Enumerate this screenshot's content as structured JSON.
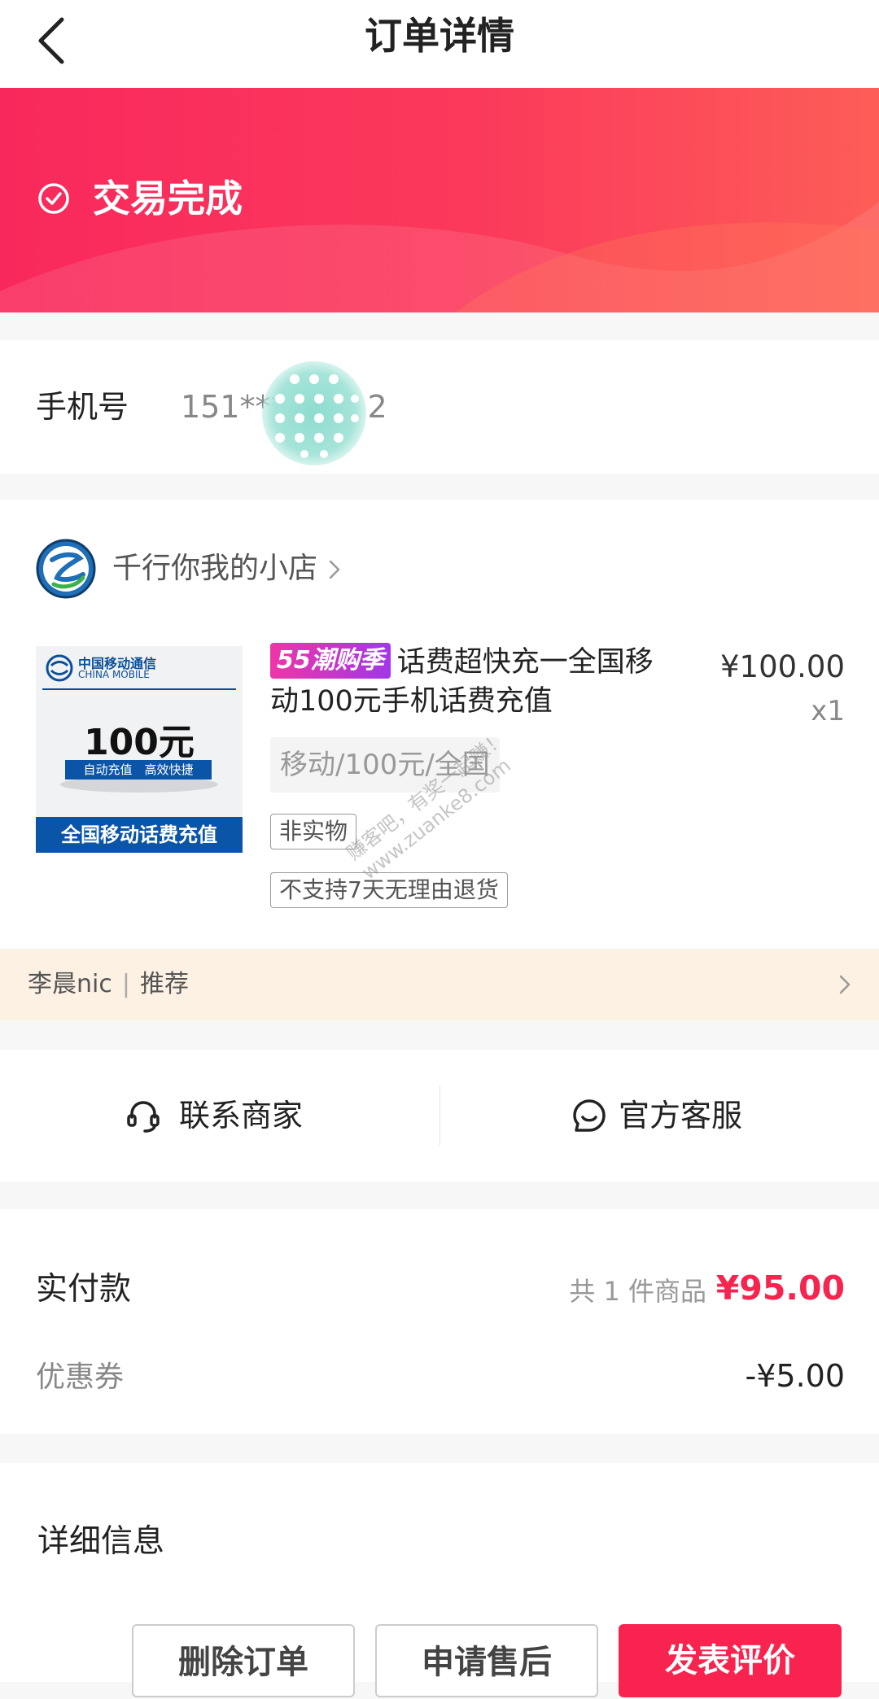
{
  "header": {
    "title": "订单详情"
  },
  "status": {
    "text": "交易完成"
  },
  "phone": {
    "label": "手机号",
    "value": "151***",
    "suffix": "2"
  },
  "shop": {
    "name": "千行你我的小店"
  },
  "product": {
    "image_brand_cn": "中国移动通信",
    "image_brand_en": "CHINA MOBILE",
    "image_amount": "100元",
    "image_tag": "自动充值　高效快捷",
    "image_bottom": "全国移动话费充值",
    "promo_badge": "55潮购季",
    "title": "话费超快充一全国移动100元手机话费充值",
    "price": "¥100.00",
    "quantity": "x1",
    "spec": "移动/100元/全国",
    "tags": [
      "非实物",
      "不支持7天无理由退货"
    ]
  },
  "watermark": {
    "line1": "赚客吧，有奖一起赚！",
    "line2": "www.zuanke8.com"
  },
  "recommend": {
    "name": "李晨nic",
    "separator": "|",
    "label": "推荐"
  },
  "contact": {
    "merchant": "联系商家",
    "service": "官方客服"
  },
  "payment": {
    "label": "实付款",
    "count": "共 1 件商品",
    "amount": "¥95.00",
    "coupon_label": "优惠券",
    "coupon_amount": "-¥5.00"
  },
  "details": {
    "title": "详细信息"
  },
  "actions": {
    "delete": "删除订单",
    "aftersale": "申请售后",
    "review": "发表评价"
  },
  "colors": {
    "accent": "#f8234e",
    "banner_start": "#f9285c",
    "banner_end": "#fd5d57",
    "recommend_bg": "#fdf1e4",
    "promo_start": "#ee36a8",
    "promo_end": "#a336e8"
  }
}
